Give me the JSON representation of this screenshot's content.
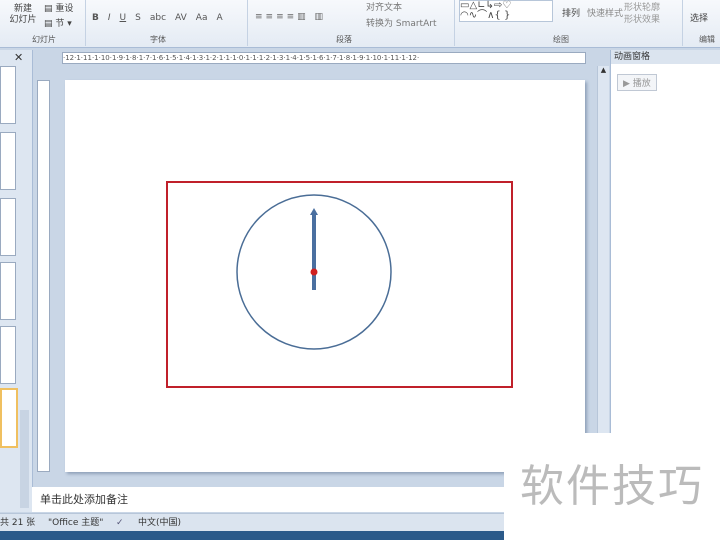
{
  "ribbon": {
    "new_slide": "新建\n幻灯片",
    "reset": "重设",
    "section": "节",
    "group_slides": "幻灯片",
    "group_font": "字体",
    "group_paragraph": "段落",
    "group_drawing": "绘图",
    "group_edit": "编辑",
    "align_text": "对齐文本",
    "convert_smartart": "转换为 SmartArt",
    "arrange": "排列",
    "quick_styles": "快速样式",
    "shape_effects": "形状效果",
    "shape_outline": "形状轮廓",
    "select": "选择",
    "font_buttons": [
      "B",
      "I",
      "U",
      "S",
      "abc",
      "AV",
      "Aa",
      "A"
    ]
  },
  "ruler": {
    "ticks": "·12·1·11·1·10·1·9·1·8·1·7·1·6·1·5·1·4·1·3·1·2·1·1·1·0·1·1·1·2·1·3·1·4·1·5·1·6·1·7·1·8·1·9·1·10·1·11·1·12·"
  },
  "animation_pane": {
    "title": "动画窗格",
    "play": "▶ 播放"
  },
  "notes": {
    "placeholder": "单击此处添加备注"
  },
  "status": {
    "slide_count": "共 21 张",
    "theme": "\"Office 主题\"",
    "language": "中文(中国)"
  },
  "watermark": "软件技巧",
  "colors": {
    "frame": "#c0202a",
    "circle": "#4a6d96",
    "hand": "#4a6fa0",
    "pivot": "#d02020"
  }
}
